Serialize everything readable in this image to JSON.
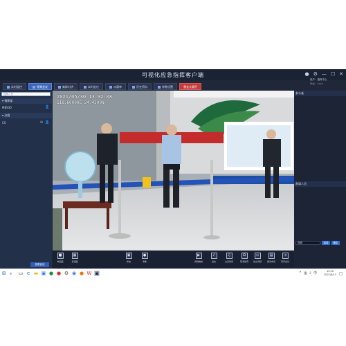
{
  "app": {
    "title": "可视化应急指挥客户端"
  },
  "user": {
    "line1": "用户：指挥中心",
    "line2": "地址：xxxx"
  },
  "tabs": [
    {
      "label": "实时监控",
      "active": false
    },
    {
      "label": "视频会议",
      "active": true
    },
    {
      "label": "集群对讲",
      "active": false
    },
    {
      "label": "实时定位",
      "active": false
    },
    {
      "label": "派遣单",
      "active": false
    },
    {
      "label": "历史资料",
      "active": false
    },
    {
      "label": "参数设置",
      "active": false
    },
    {
      "label": "我宝大屏杆",
      "active": false,
      "alert": true
    }
  ],
  "sidebar": {
    "search_placeholder": "搜索人员",
    "group1": "指挥部",
    "item1": "MBS30",
    "group2": "分组",
    "item2": "CS",
    "bottom_button": "挂断会议"
  },
  "video": {
    "timestamp": "2021/05/30 13:32:08",
    "coords": "118.60000E  24.4300N"
  },
  "toolbar": {
    "left": [
      {
        "label": "单画面",
        "icon": "single-screen-icon"
      },
      {
        "label": "多画面",
        "icon": "multi-screen-icon"
      },
      {
        "label": "抓拍",
        "icon": "snapshot-icon"
      },
      {
        "label": "录像",
        "icon": "record-icon"
      }
    ],
    "right": [
      {
        "label": "视频推送",
        "icon": "video-push-icon"
      },
      {
        "label": "发言",
        "icon": "microphone-icon"
      },
      {
        "label": "全员静音",
        "icon": "mute-all-icon"
      },
      {
        "label": "取消静音",
        "icon": "headset-icon"
      },
      {
        "label": "禁止视频",
        "icon": "camera-off-icon"
      },
      {
        "label": "邀请成员",
        "icon": "invite-icon"
      },
      {
        "label": "离开会议",
        "icon": "leave-icon"
      }
    ]
  },
  "right_panel": {
    "header1": "参与者",
    "header2": "邀请人员",
    "select_value": "视频",
    "btn1": "选择",
    "btn2": "确定"
  },
  "taskbar": {
    "time": "15:20",
    "date": "2021/6/11"
  }
}
